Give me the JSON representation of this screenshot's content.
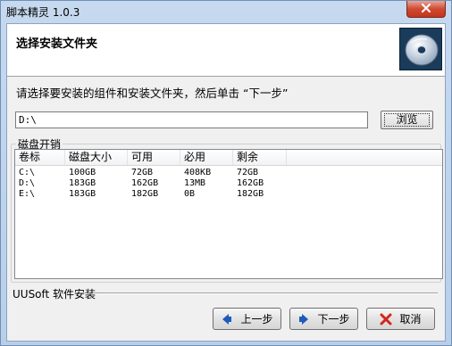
{
  "window": {
    "title": "脚本精灵 1.0.3"
  },
  "header": {
    "title": "选择安装文件夹"
  },
  "instruction": "请选择要安装的组件和安装文件夹，然后单击 “下一步”",
  "path": {
    "value": "D:\\"
  },
  "browse_label": "浏览",
  "disk_group": {
    "label": "磁盘开销",
    "columns": [
      "卷标",
      "磁盘大小",
      "可用",
      "必用",
      "剩余"
    ],
    "rows": [
      [
        "C:\\",
        "100GB",
        "72GB",
        "408KB",
        "72GB"
      ],
      [
        "D:\\",
        "183GB",
        "162GB",
        "13MB",
        "162GB"
      ],
      [
        "E:\\",
        "183GB",
        "182GB",
        "0B",
        "182GB"
      ]
    ]
  },
  "brand": "UUSoft 软件安装",
  "buttons": {
    "back": "上一步",
    "next": "下一步",
    "cancel": "取消"
  },
  "icons": {
    "close": "close-icon",
    "cd": "cd-disc-icon",
    "back": "arrow-left-icon",
    "next": "arrow-right-icon",
    "cancel": "red-x-icon"
  },
  "colors": {
    "titlebar": "#c6d9ee",
    "close": "#c2341b",
    "arrow": "#1e5bb8",
    "cancel": "#d3261b"
  }
}
